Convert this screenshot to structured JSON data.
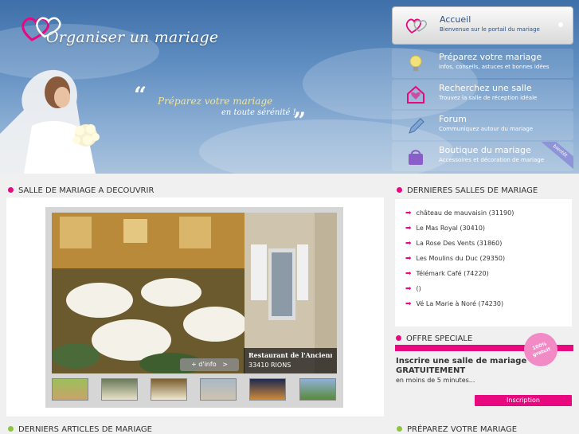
{
  "header": {
    "logo_text": "Organiser un mariage",
    "slogan_main": "Préparez votre mariage",
    "slogan_sub": "en toute sérénité !",
    "quote_open": "“",
    "quote_close": "”"
  },
  "nav": {
    "items": [
      {
        "title": "Accueil",
        "sub": "Bienvenue sur le portail du mariage",
        "icon": "hearts-icon"
      },
      {
        "title": "Préparez votre mariage",
        "sub": "infos, conseils, astuces et bonnes idées",
        "icon": "lightbulb-icon"
      },
      {
        "title": "Recherchez une salle",
        "sub": "Trouvez la salle de réception idéale",
        "icon": "house-icon"
      },
      {
        "title": "Forum",
        "sub": "Communiquez autour du mariage",
        "icon": "pencil-icon"
      },
      {
        "title": "Boutique du mariage",
        "sub": "Accessoires et décoration de mariage",
        "icon": "shopping-bag-icon",
        "ribbon": "bientôt"
      }
    ]
  },
  "featured": {
    "heading": "SALLE DE MARIAGE A DECOUVRIR",
    "caption_name": "Restaurant de l'Ancienne I",
    "caption_location": "33410 RIONS",
    "info_button": "+ d'info",
    "info_arrow": ">"
  },
  "latest_venues": {
    "heading": "DERNIERES SALLES DE MARIAGE",
    "items": [
      "château de mauvaisin (31190)",
      "Le Mas Royal (30410)",
      "La Rose Des Vents (31860)",
      "Les Moulins du Duc (29350)",
      "Télémark Café (74220)",
      "()",
      "Vé La Marie à Noré (74230)"
    ]
  },
  "offer": {
    "heading": "OFFRE SPECIALE",
    "badge": "100% gratuit",
    "line1": "Inscrire une salle de mariage",
    "line2": "GRATUITEMENT",
    "line3": "en moins de 5 minutes...",
    "button": "Inscription"
  },
  "bottom": {
    "left_heading": "DERNIERS ARTICLES DE MARIAGE",
    "right_heading": "PRÉPAREZ VOTRE MARIAGE"
  },
  "colors": {
    "accent_pink": "#e8087f",
    "accent_green": "#8cc63f",
    "header_blue": "#3e6fa8"
  }
}
